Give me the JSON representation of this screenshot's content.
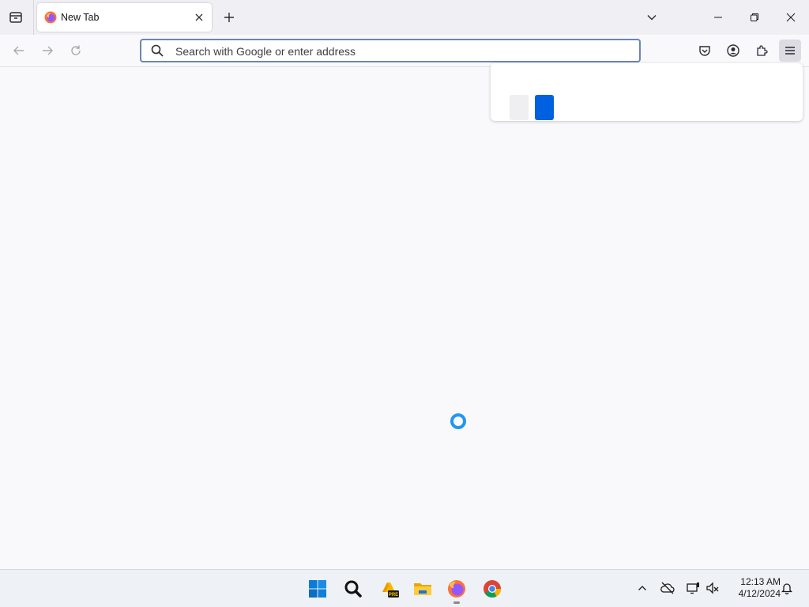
{
  "browser": {
    "tab": {
      "title": "New Tab"
    },
    "urlbar": {
      "placeholder": "Search with Google or enter address",
      "value": ""
    },
    "accent_color": "#0061e0"
  },
  "taskbar": {
    "apps": [
      {
        "name": "Start",
        "icon": "windows-logo-icon"
      },
      {
        "name": "Search",
        "icon": "search-icon"
      },
      {
        "name": "PRE",
        "icon": "preview-app-icon"
      },
      {
        "name": "File Explorer",
        "icon": "folder-icon"
      },
      {
        "name": "Firefox",
        "icon": "firefox-icon"
      },
      {
        "name": "Chrome",
        "icon": "chrome-icon"
      }
    ],
    "clock": {
      "time": "12:13 AM",
      "date": "4/12/2024"
    }
  }
}
